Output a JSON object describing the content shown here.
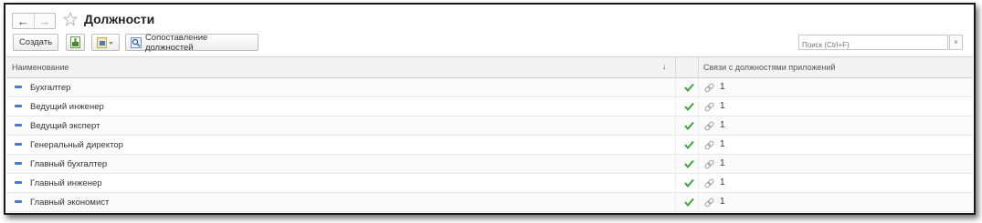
{
  "window": {
    "title": "Должности",
    "nav": {
      "back_icon": "arrow-left-icon",
      "forward_icon": "arrow-right-icon"
    },
    "favorite_icon": "star-icon"
  },
  "toolbar": {
    "create_label": "Создать",
    "export_icon": "export-file-icon",
    "import_icon": "import-menu-icon",
    "match_label": "Сопоставление должностей",
    "match_icon": "match-search-icon",
    "search_placeholder": "Поиск (Ctrl+F)",
    "search_clear_label": "×"
  },
  "table": {
    "columns": {
      "name": "Наименование",
      "sort_indicator": "↓",
      "links": "Связи с должностями приложений"
    },
    "rows": [
      {
        "name": "Бухгалтер",
        "count": "1"
      },
      {
        "name": "Ведущий инженер",
        "count": "1"
      },
      {
        "name": "Ведущий эксперт",
        "count": "1"
      },
      {
        "name": "Генеральный директор",
        "count": "1"
      },
      {
        "name": "Главный бухгалтер",
        "count": "1"
      },
      {
        "name": "Главный инженер",
        "count": "1"
      },
      {
        "name": "Главный экономист",
        "count": "1"
      }
    ]
  },
  "colors": {
    "accent_blue": "#4a79c9",
    "check_green": "#3aa53a",
    "header_bg": "#f2f2f2"
  }
}
